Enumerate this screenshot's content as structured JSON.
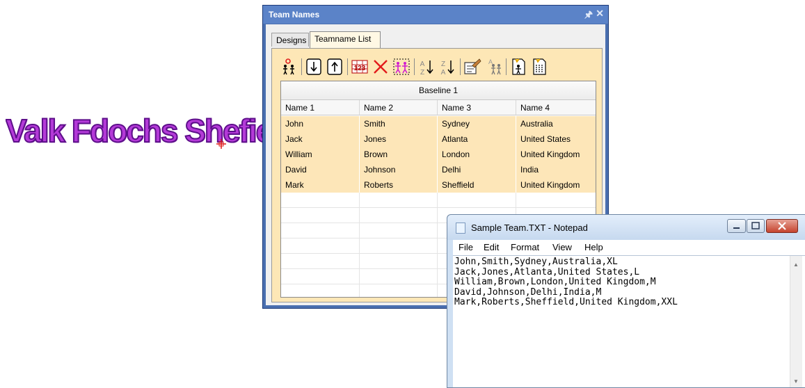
{
  "embroidery": {
    "text": "Valk Fdochs Shefiedd",
    "color": "#b43ad8"
  },
  "panel": {
    "title": "Team Names",
    "pin_icon": "pin-icon",
    "close_icon": "close-icon",
    "tabs": [
      {
        "label": "Designs",
        "active": false
      },
      {
        "label": "Teamname List",
        "active": true
      }
    ],
    "toolbar": [
      {
        "name": "add-teamname-icon"
      },
      {
        "name": "move-down-icon"
      },
      {
        "name": "move-up-icon"
      },
      {
        "name": "number-column-icon",
        "text": "123"
      },
      {
        "name": "delete-icon"
      },
      {
        "name": "select-all-names-icon"
      },
      {
        "name": "sort-ascending-icon",
        "text": "A Z"
      },
      {
        "name": "sort-descending-icon",
        "text": "Z A"
      },
      {
        "name": "edit-list-icon"
      },
      {
        "name": "add-baseline-icon"
      },
      {
        "name": "import-names-icon"
      },
      {
        "name": "export-names-icon"
      }
    ],
    "grid": {
      "baseline": "Baseline 1",
      "columns": [
        "Name 1",
        "Name 2",
        "Name 3",
        "Name 4"
      ],
      "rows": [
        [
          "John",
          "Smith",
          "Sydney",
          "Australia"
        ],
        [
          "Jack",
          "Jones",
          "Atlanta",
          "United States"
        ],
        [
          "William",
          "Brown",
          "London",
          "United Kingdom"
        ],
        [
          "David",
          "Johnson",
          "Delhi",
          "India"
        ],
        [
          "Mark",
          "Roberts",
          "Sheffield",
          "United Kingdom"
        ]
      ]
    }
  },
  "notepad": {
    "title": "Sample Team.TXT - Notepad",
    "menu": [
      "File",
      "Edit",
      "Format",
      "View",
      "Help"
    ],
    "text": "John,Smith,Sydney,Australia,XL\nJack,Jones,Atlanta,United States,L\nWilliam,Brown,London,United Kingdom,M\nDavid,Johnson,Delhi,India,M\nMark,Roberts,Sheffield,United Kingdom,XXL"
  }
}
